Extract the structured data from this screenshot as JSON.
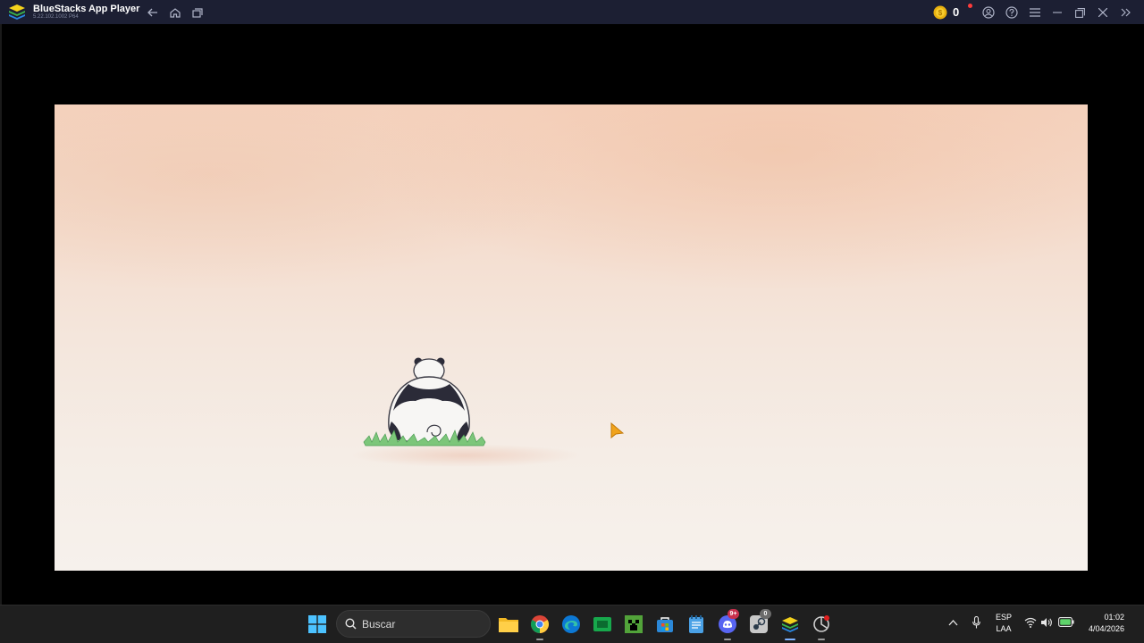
{
  "titlebar": {
    "app_name": "BlueStacks App Player",
    "app_version": "5.22.102.1002 P64",
    "coins": "0",
    "buttons": [
      "back-icon",
      "home-icon",
      "multi-instance-icon",
      "coin-icon",
      "account-icon",
      "help-icon",
      "menu-icon",
      "minimize-icon",
      "restore-icon",
      "close-icon",
      "expand-sidebar-icon"
    ]
  },
  "screen": {
    "content": "panda-video-scene",
    "colors": {
      "sky_top": "#f5d3bf",
      "ground": "#f6f1ec",
      "grass": "#7cc67a",
      "cursor": "#f0a31c"
    }
  },
  "taskbar": {
    "search_placeholder": "Buscar",
    "pinned_apps": [
      "windows-start-icon",
      "file-explorer-icon",
      "chrome-icon",
      "edge-icon",
      "green-app-icon",
      "minecraft-icon",
      "microsoft-store-icon",
      "notepad-icon",
      "discord-icon",
      "steam-icon",
      "bluestacks-icon",
      "app-icon"
    ],
    "discord_badge": "9+",
    "steam_badge": "0",
    "language_line1": "ESP",
    "language_line2": "LAA",
    "time": "01:02",
    "date": "4/04/2026",
    "tray_icons": [
      "show-hidden-icons-chevron",
      "microphone-icon",
      "wifi-icon",
      "volume-icon",
      "battery-icon"
    ]
  }
}
